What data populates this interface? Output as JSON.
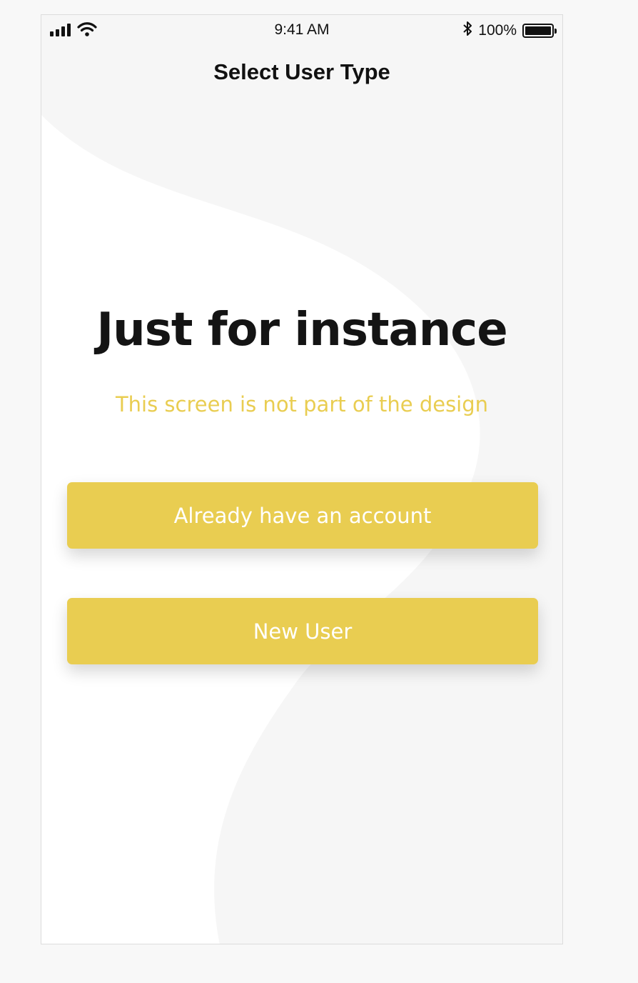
{
  "status_bar": {
    "time": "9:41 AM",
    "battery_text": "100%",
    "icons": [
      "signal-icon",
      "wifi-icon",
      "bluetooth-icon",
      "battery-icon"
    ]
  },
  "nav": {
    "title": "Select User Type"
  },
  "main": {
    "headline": "Just for instance",
    "subtitle": "This screen is not part of the design"
  },
  "buttons": {
    "existing_account_label": "Already have an account",
    "new_user_label": "New User"
  },
  "colors": {
    "accent": "#e9cd51",
    "background": "#f6f6f6",
    "text_primary": "#141414",
    "button_text": "#ffffff"
  }
}
